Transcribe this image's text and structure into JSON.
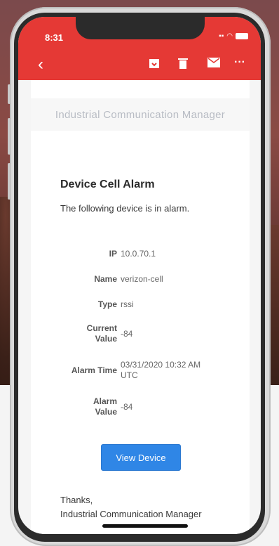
{
  "status_bar": {
    "time": "8:31"
  },
  "colors": {
    "header": "#e53935",
    "button": "#2f86e6"
  },
  "toolbar": {
    "back_icon": "chevron-left-icon",
    "icons": [
      "archive-icon",
      "trash-icon",
      "mail-icon",
      "more-icon"
    ],
    "more_label": "···"
  },
  "email": {
    "banner": "Industrial Communication Manager",
    "title": "Device Cell Alarm",
    "intro": "The following device is in alarm.",
    "fields": [
      {
        "label": "IP",
        "value": "10.0.70.1"
      },
      {
        "label": "Name",
        "value": "verizon-cell"
      },
      {
        "label": "Type",
        "value": "rssi"
      },
      {
        "label": "Current Value",
        "value": "-84"
      },
      {
        "label": "Alarm Time",
        "value": "03/31/2020 10:32 AM UTC"
      },
      {
        "label": "Alarm Value",
        "value": "-84"
      }
    ],
    "button_label": "View Device",
    "signoff": "Thanks,",
    "signature": "Industrial Communication Manager"
  }
}
